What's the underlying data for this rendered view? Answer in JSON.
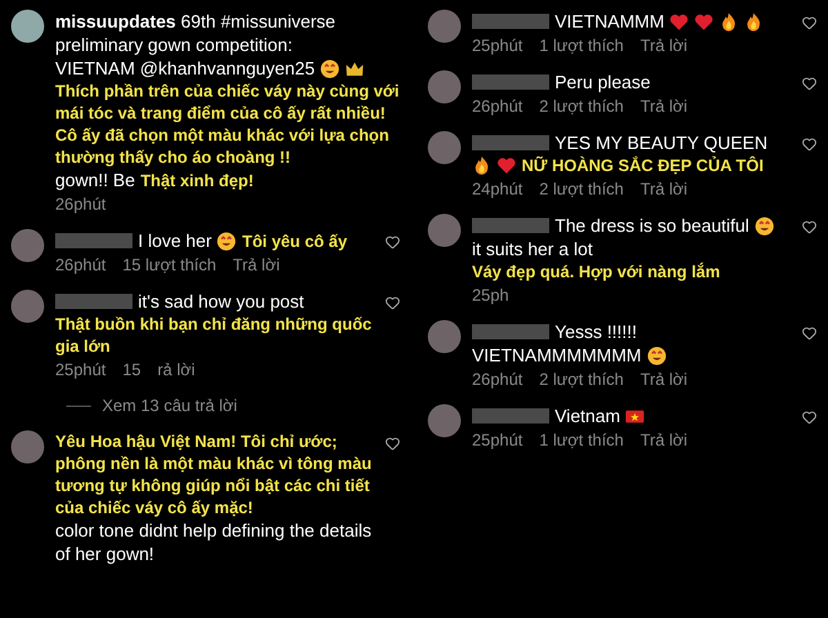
{
  "columns": [
    {
      "comments": [
        {
          "kind": "caption",
          "parts": [
            {
              "kind": "paragraph",
              "text": "**missuupdates** 69th #missuniverse preliminary gown competition:"
            },
            {
              "kind": "text",
              "text": "VIETNAM @khanhvannguyen25"
            },
            {
              "kind": "smile"
            },
            {
              "kind": "crown"
            },
            {
              "kind": "translation_block",
              "text": "Thích phần trên của chiếc váy này cùng với mái tóc và trang điểm của cô ấy rất nhiều! Cô ấy đã chọn một màu khác với lựa chọn thường thấy cho áo choàng !!"
            },
            {
              "kind": "text",
              "text": "gown!! Be"
            },
            {
              "kind": "translation",
              "text": "Thật xinh đẹp!"
            }
          ],
          "time": "26phút"
        },
        {
          "kind": "comment",
          "parts": [
            {
              "kind": "text",
              "text": "I love her"
            },
            {
              "kind": "smile"
            },
            {
              "kind": "translation",
              "text": "Tôi yêu cô ấy"
            }
          ],
          "time": "26phút",
          "likes": "15 lượt thích",
          "reply": "Trả lời"
        },
        {
          "kind": "comment",
          "parts": [
            {
              "kind": "text",
              "text": "it's sad how you post"
            },
            {
              "kind": "translation_block",
              "text": "Thật buồn khi bạn chỉ đăng những quốc gia lớn"
            }
          ],
          "time": "25phút",
          "likes": "15",
          "reply": "rả lời"
        },
        {
          "kind": "replies",
          "text": "Xem 13 câu trả lời"
        },
        {
          "kind": "comment",
          "parts": [
            {
              "kind": "translation_block",
              "text": "Yêu Hoa hậu Việt Nam! Tôi chỉ ước; phông nền là một màu khác vì tông màu tương tự không giúp nổi bật các chi tiết của chiếc váy cô ấy mặc!"
            },
            {
              "kind": "paragraph",
              "text": "color tone didnt help defining the details of her gown!"
            }
          ]
        }
      ]
    },
    {
      "comments": [
        {
          "kind": "comment",
          "parts": [
            {
              "kind": "text",
              "text": "VIETNAMMM"
            },
            {
              "kind": "heart"
            },
            {
              "kind": "heart"
            },
            {
              "kind": "fire"
            },
            {
              "kind": "fire"
            }
          ],
          "time": "25phút",
          "likes": "1 lượt thích",
          "reply": "Trả lời"
        },
        {
          "kind": "comment",
          "parts": [
            {
              "kind": "text",
              "text": "Peru please"
            }
          ],
          "time": "26phút",
          "likes": "2 lượt thích",
          "reply": "Trả lời"
        },
        {
          "kind": "comment",
          "parts": [
            {
              "kind": "text",
              "text": "YES MY BEAUTY QUEEN"
            },
            {
              "kind": "fire"
            },
            {
              "kind": "heart"
            },
            {
              "kind": "translation",
              "text": "NỮ HOÀNG SẮC ĐẸP CỦA TÔI"
            }
          ],
          "time": "24phút",
          "likes": "2 lượt thích",
          "reply": "Trả lời"
        },
        {
          "kind": "comment",
          "parts": [
            {
              "kind": "text",
              "text": "The dress is so beautiful"
            },
            {
              "kind": "smile"
            },
            {
              "kind": "text",
              "text": "it suits her a lot"
            },
            {
              "kind": "translation",
              "text": "Váy đẹp quá. Hợp với nàng lắm"
            }
          ],
          "time": "25ph"
        },
        {
          "kind": "comment",
          "parts": [
            {
              "kind": "text",
              "text": "Yesss !!!!!!"
            },
            {
              "kind": "text",
              "text": "VIETNAMMMMMMM"
            },
            {
              "kind": "smile"
            }
          ],
          "time": "26phút",
          "likes": "2 lượt thích",
          "reply": "Trả lời"
        },
        {
          "kind": "comment",
          "parts": [
            {
              "kind": "text",
              "text": "Vietnam"
            },
            {
              "kind": "flag"
            }
          ],
          "time": "25phút",
          "likes": "1 lượt thích",
          "reply": "Trả lời"
        }
      ]
    }
  ]
}
